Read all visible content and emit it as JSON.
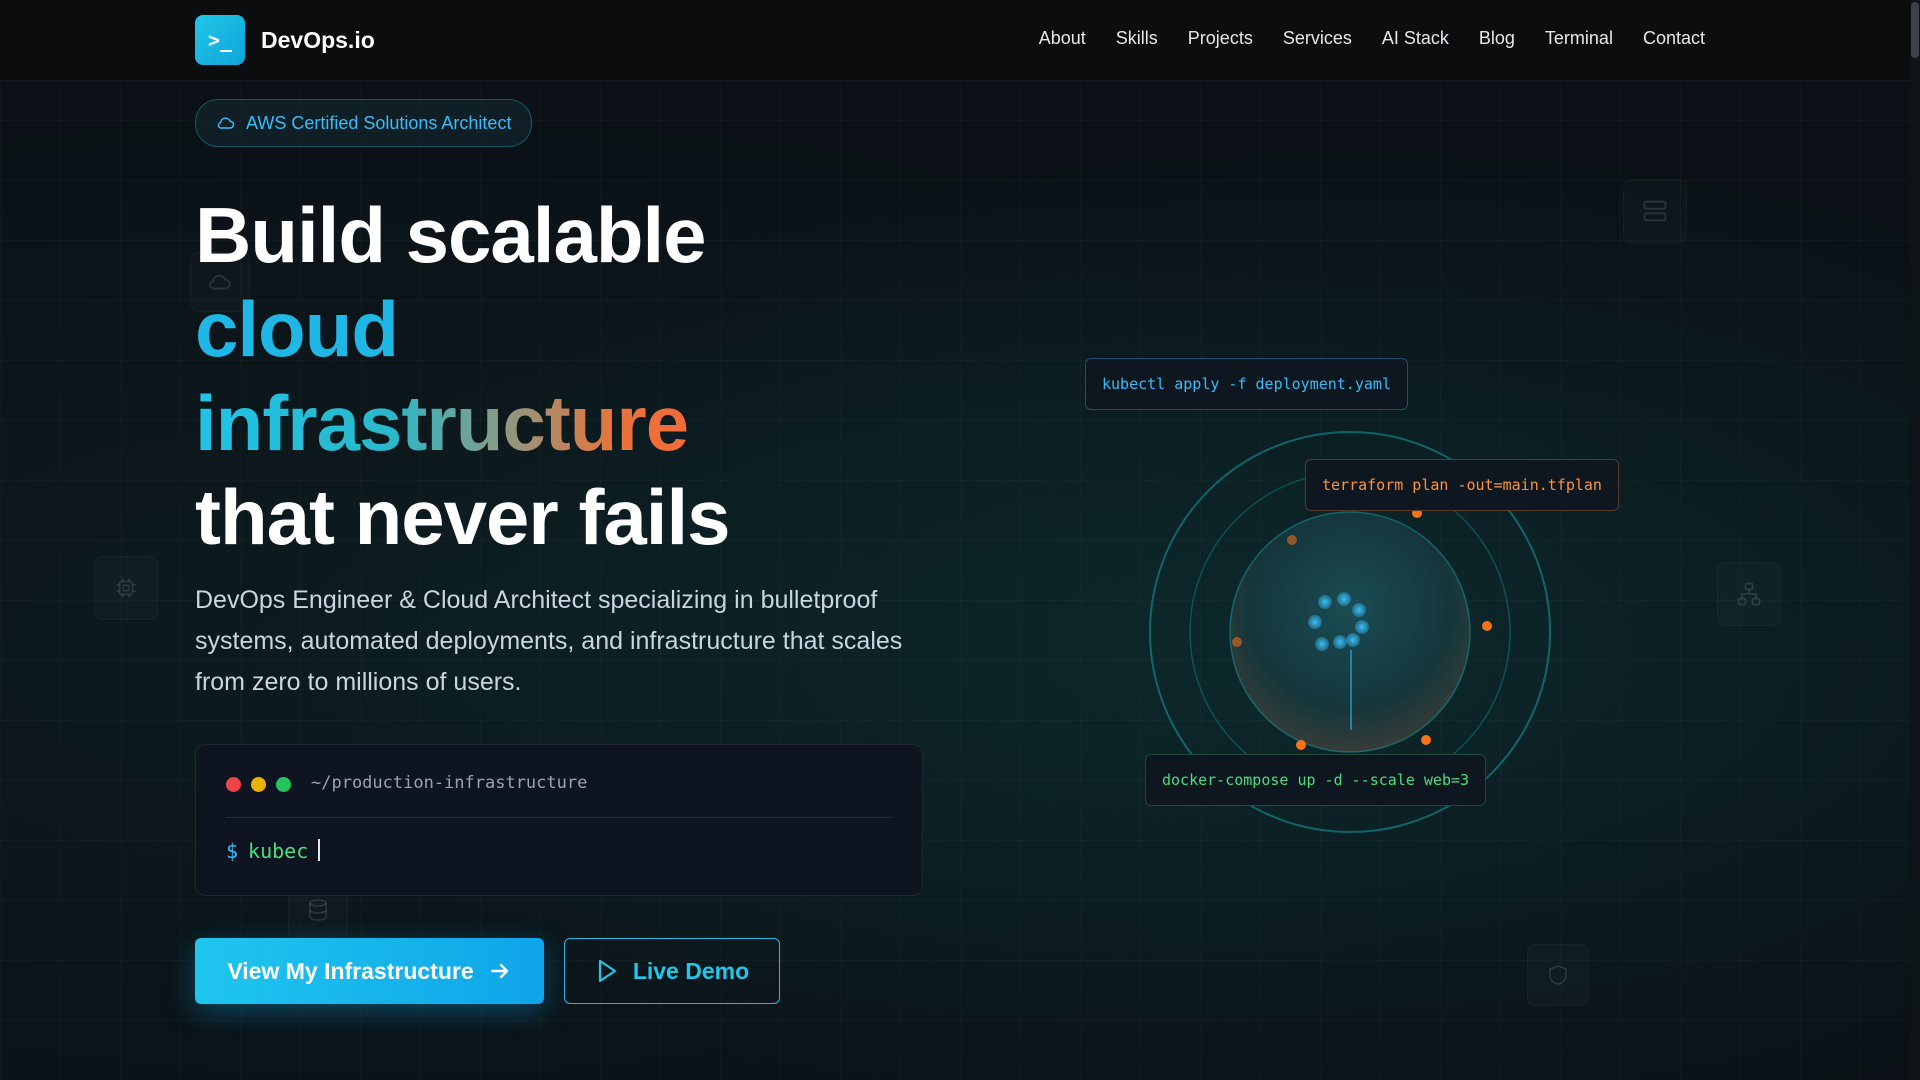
{
  "brand": {
    "logo_glyph": ">_",
    "name": "DevOps.io",
    "accent": "#22c7e8"
  },
  "nav": {
    "items": [
      "About",
      "Skills",
      "Projects",
      "Services",
      "AI Stack",
      "Blog",
      "Terminal",
      "Contact"
    ]
  },
  "badge": {
    "icon": "cloud-icon",
    "label": "AWS Certified Solutions Architect"
  },
  "hero": {
    "line1": "Build scalable",
    "line2": "cloud",
    "line3": "infrastructure",
    "line4": "that never fails",
    "subtitle": "DevOps Engineer & Cloud Architect specializing in bulletproof systems, automated deployments, and infrastructure that scales from zero to millions of users."
  },
  "terminal": {
    "path": "~/production-infrastructure",
    "prompt": "$",
    "typed": "kubec"
  },
  "buttons": {
    "primary_label": "View My Infrastructure",
    "secondary_label": "Live Demo"
  },
  "diagram": {
    "commands": {
      "kubectl": "kubectl apply -f deployment.yaml",
      "terraform": "terraform plan -out=main.tfplan",
      "docker": "docker-compose up -d --scale web=3"
    },
    "colors": {
      "ring": "#14b8c4",
      "node": "#38bdf8",
      "orbit_dot": "#f97316"
    }
  },
  "decor_icons": [
    "server-icon",
    "cloud-icon",
    "cpu-icon",
    "network-icon",
    "database-icon",
    "shield-icon"
  ]
}
